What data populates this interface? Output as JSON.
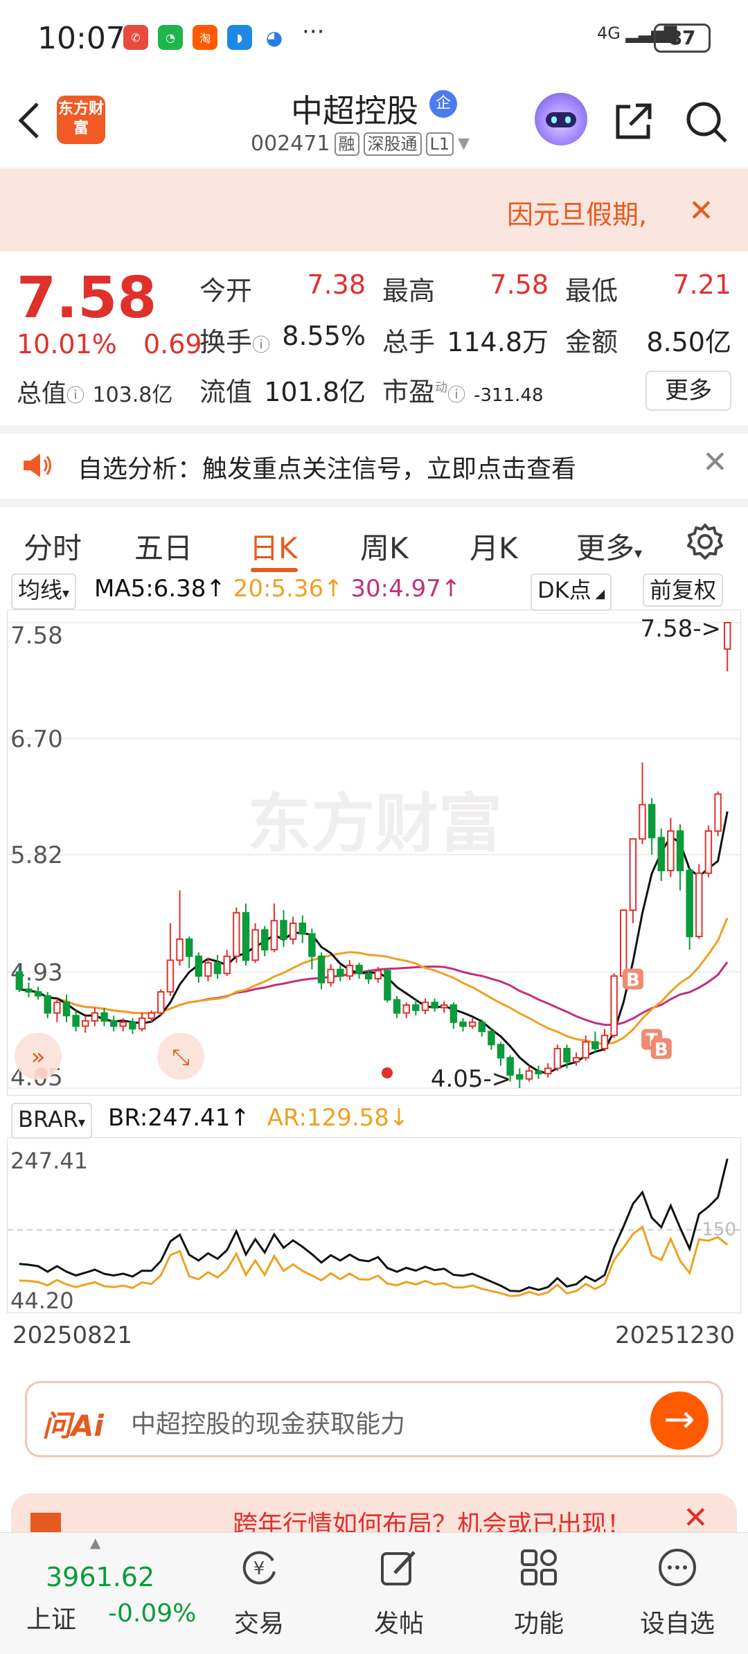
{
  "status_bar": {
    "time": "10:07",
    "app_icons": [
      "missed-call-icon",
      "wechat-icon",
      "taobao-icon",
      "message-icon",
      "app-icon"
    ],
    "more": "···",
    "network": "4G",
    "battery": "87"
  },
  "header": {
    "logo_text": "东方财富",
    "stock_name": "中超控股",
    "qi_badge": "企",
    "stock_code": "002471",
    "tags": [
      "融",
      "深股通",
      "L1"
    ]
  },
  "banner": {
    "text": "因元旦假期,"
  },
  "quote": {
    "price": "7.58",
    "change_pct": "10.01%",
    "change_amt": "0.69",
    "market_value_label": "总值",
    "market_value": "103.8亿",
    "open_label": "今开",
    "open": "7.38",
    "high_label": "最高",
    "high": "7.58",
    "low_label": "最低",
    "low": "7.21",
    "turnover_label": "换手",
    "turnover": "8.55%",
    "volume_label": "总手",
    "volume": "114.8万",
    "amount_label": "金额",
    "amount": "8.50亿",
    "float_label": "流值",
    "float_value": "101.8亿",
    "pe_label": "市盈",
    "pe_sup": "动",
    "pe": "-311.48",
    "more_label": "更多"
  },
  "notice": {
    "text": "自选分析：触发重点关注信号，立即点击查看"
  },
  "tabs": [
    "分时",
    "五日",
    "日K",
    "周K",
    "月K",
    "更多"
  ],
  "active_tab": "日K",
  "indicator_bar": {
    "ma_select": "均线",
    "ma5": "MA5:6.38↑",
    "ma20": "20:5.36↑",
    "ma30": "30:4.97↑",
    "dk_label": "DK点",
    "adjust_label": "前复权"
  },
  "kchart": {
    "y_labels": [
      "7.58",
      "6.70",
      "5.82",
      "4.93",
      "4.05"
    ],
    "watermark": "东方财富",
    "max_label": "7.58->",
    "min_label": "4.05->",
    "marker_b": "B",
    "marker_t": "T"
  },
  "br_bar": {
    "select": "BRAR",
    "br": "BR:247.41↑",
    "ar": "AR:129.58↓"
  },
  "brchart": {
    "y_top": "247.41",
    "y_bottom": "44.20",
    "ref_line": "150"
  },
  "dates": {
    "start": "20250821",
    "end": "20251230"
  },
  "ai_box": {
    "logo": "问Ai",
    "prompt": "中超控股的现金获取能力"
  },
  "promo": {
    "text": "跨年行情如何布局？机会或已出现！"
  },
  "bottom_nav": {
    "index_value": "3961.62",
    "index_name": "上证",
    "index_change": "-0.09%",
    "items": [
      "交易",
      "发帖",
      "功能",
      "设自选"
    ]
  },
  "colors": {
    "up": "#e0302c",
    "down": "#0a9b3a",
    "accent": "#e65a1f",
    "ma5": "#111111",
    "ma20": "#f0a020",
    "ma30": "#c0307a"
  },
  "chart_data": {
    "type": "candlestick",
    "y_range": [
      4.05,
      7.58
    ],
    "start_date": "20250821",
    "end_date": "20251230",
    "last": {
      "close": 7.58,
      "open": 7.38,
      "high": 7.58,
      "low": 7.21
    },
    "ma5_last": 6.38,
    "ma20_last": 5.36,
    "ma30_last": 4.97,
    "candles": [
      [
        4.93,
        4.8,
        4.98,
        4.78
      ],
      [
        4.8,
        4.78,
        4.85,
        4.74
      ],
      [
        4.78,
        4.75,
        4.82,
        4.72
      ],
      [
        4.75,
        4.62,
        4.78,
        4.58
      ],
      [
        4.62,
        4.7,
        4.73,
        4.55
      ],
      [
        4.7,
        4.6,
        4.76,
        4.55
      ],
      [
        4.6,
        4.52,
        4.64,
        4.48
      ],
      [
        4.52,
        4.56,
        4.6,
        4.47
      ],
      [
        4.56,
        4.62,
        4.66,
        4.52
      ],
      [
        4.62,
        4.56,
        4.66,
        4.52
      ],
      [
        4.56,
        4.52,
        4.6,
        4.48
      ],
      [
        4.52,
        4.55,
        4.58,
        4.48
      ],
      [
        4.55,
        4.5,
        4.58,
        4.46
      ],
      [
        4.5,
        4.58,
        4.62,
        4.48
      ],
      [
        4.58,
        4.62,
        4.64,
        4.55
      ],
      [
        4.62,
        4.78,
        4.8,
        4.6
      ],
      [
        4.78,
        5.02,
        5.3,
        4.75
      ],
      [
        5.02,
        5.18,
        5.55,
        4.98
      ],
      [
        5.18,
        5.05,
        5.2,
        4.96
      ],
      [
        5.05,
        4.9,
        5.08,
        4.85
      ],
      [
        4.9,
        5.0,
        5.04,
        4.86
      ],
      [
        5.0,
        4.92,
        5.06,
        4.88
      ],
      [
        4.92,
        5.05,
        5.1,
        4.9
      ],
      [
        5.05,
        5.38,
        5.42,
        5.0
      ],
      [
        5.38,
        5.02,
        5.45,
        4.98
      ],
      [
        5.02,
        5.25,
        5.3,
        5.0
      ],
      [
        5.25,
        5.1,
        5.28,
        5.05
      ],
      [
        5.1,
        5.32,
        5.45,
        5.08
      ],
      [
        5.32,
        5.18,
        5.4,
        5.12
      ],
      [
        5.18,
        5.3,
        5.35,
        5.14
      ],
      [
        5.3,
        5.22,
        5.36,
        5.15
      ],
      [
        5.22,
        5.05,
        5.26,
        4.95
      ],
      [
        5.05,
        4.85,
        5.08,
        4.8
      ],
      [
        4.85,
        4.95,
        4.99,
        4.82
      ],
      [
        4.95,
        4.9,
        4.98,
        4.86
      ],
      [
        4.9,
        4.98,
        5.02,
        4.87
      ],
      [
        4.98,
        4.92,
        5.0,
        4.88
      ],
      [
        4.92,
        4.88,
        4.95,
        4.84
      ],
      [
        4.88,
        4.94,
        4.97,
        4.85
      ],
      [
        4.94,
        4.72,
        4.96,
        4.7
      ],
      [
        4.72,
        4.62,
        4.75,
        4.58
      ],
      [
        4.62,
        4.68,
        4.7,
        4.58
      ],
      [
        4.68,
        4.64,
        4.72,
        4.6
      ],
      [
        4.64,
        4.7,
        4.73,
        4.61
      ],
      [
        4.7,
        4.66,
        4.73,
        4.63
      ],
      [
        4.66,
        4.68,
        4.71,
        4.62
      ],
      [
        4.68,
        4.55,
        4.7,
        4.5
      ],
      [
        4.55,
        4.52,
        4.58,
        4.48
      ],
      [
        4.52,
        4.55,
        4.58,
        4.5
      ],
      [
        4.55,
        4.48,
        4.57,
        4.44
      ],
      [
        4.48,
        4.38,
        4.5,
        4.34
      ],
      [
        4.38,
        4.28,
        4.4,
        4.22
      ],
      [
        4.28,
        4.15,
        4.3,
        4.1
      ],
      [
        4.15,
        4.12,
        4.2,
        4.05
      ],
      [
        4.12,
        4.18,
        4.22,
        4.1
      ],
      [
        4.18,
        4.16,
        4.22,
        4.12
      ],
      [
        4.16,
        4.2,
        4.24,
        4.13
      ],
      [
        4.2,
        4.35,
        4.38,
        4.18
      ],
      [
        4.35,
        4.25,
        4.38,
        4.2
      ],
      [
        4.25,
        4.28,
        4.32,
        4.22
      ],
      [
        4.28,
        4.4,
        4.45,
        4.26
      ],
      [
        4.4,
        4.35,
        4.48,
        4.32
      ],
      [
        4.35,
        4.45,
        4.5,
        4.33
      ],
      [
        4.45,
        4.9,
        4.92,
        4.43
      ],
      [
        4.9,
        5.4,
        5.4,
        4.88
      ],
      [
        5.4,
        5.94,
        5.94,
        5.3
      ],
      [
        5.94,
        6.2,
        6.52,
        5.9
      ],
      [
        6.2,
        5.95,
        6.25,
        5.82
      ],
      [
        5.95,
        5.7,
        6.02,
        5.62
      ],
      [
        5.7,
        6.0,
        6.1,
        5.65
      ],
      [
        6.0,
        5.7,
        6.05,
        5.55
      ],
      [
        5.7,
        5.2,
        5.72,
        5.1
      ],
      [
        5.2,
        5.68,
        5.75,
        5.18
      ],
      [
        5.68,
        6.0,
        6.04,
        5.65
      ],
      [
        6.0,
        6.28,
        6.3,
        5.96
      ],
      [
        7.38,
        7.58,
        7.58,
        7.21
      ]
    ],
    "brar": {
      "br_range": [
        44.2,
        247.41
      ],
      "br_last": 247.41,
      "ar_last": 129.58,
      "ref_level": 150
    }
  }
}
